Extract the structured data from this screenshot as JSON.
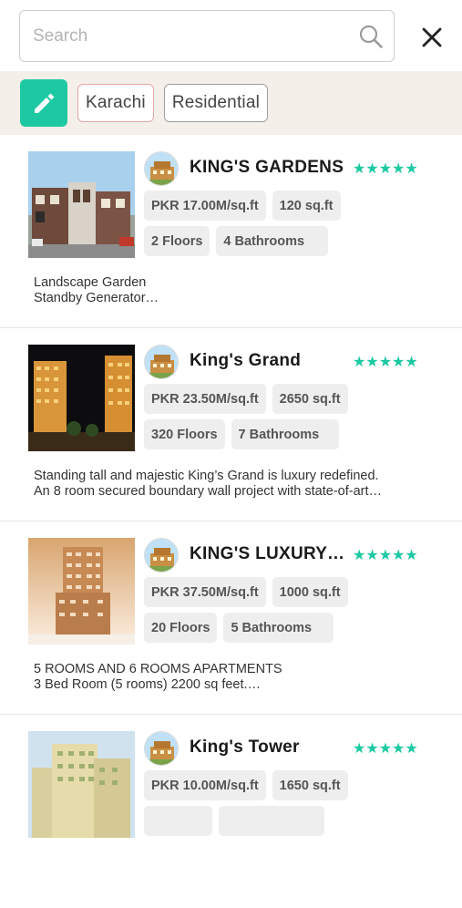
{
  "search": {
    "placeholder": "Search",
    "value": "",
    "icon": "search-icon"
  },
  "header": {
    "close_icon": "close-icon"
  },
  "filters": {
    "edit_icon": "pencil-icon",
    "city": "Karachi",
    "property_type": "Residential",
    "accent": "#1dc9a2"
  },
  "listings": [
    {
      "title": "KING'S GARDENS",
      "stars": "★★★★★",
      "price": "PKR 17.00M/sq.ft",
      "area": "120 sq.ft",
      "floors": "2 Floors",
      "bathrooms": "4 Bathrooms",
      "desc_line1": "Landscape Garden",
      "desc_line2": "Standby Generator…"
    },
    {
      "title": "King's Grand",
      "stars": "★★★★★",
      "price": "PKR 23.50M/sq.ft",
      "area": "2650 sq.ft",
      "floors": "320 Floors",
      "bathrooms": "7 Bathrooms",
      "desc_line1": "Standing tall and majestic King’s Grand is luxury redefined.",
      "desc_line2": "An 8 room secured boundary wall project with state-of-art…"
    },
    {
      "title": "KING'S LUXURY RESIDENCY",
      "stars": "★★★★★",
      "price": "PKR 37.50M/sq.ft",
      "area": "1000 sq.ft",
      "floors": "20 Floors",
      "bathrooms": "5 Bathrooms",
      "desc_line1": "5 ROOMS AND 6 ROOMS APARTMENTS",
      "desc_line2": "3 Bed Room (5 rooms) 2200 sq feet.…"
    },
    {
      "title": "King's Tower",
      "stars": "★★★★★",
      "price": "PKR 10.00M/sq.ft",
      "area": "1650 sq.ft",
      "floors": "",
      "bathrooms": "",
      "desc_line1": "",
      "desc_line2": ""
    }
  ]
}
